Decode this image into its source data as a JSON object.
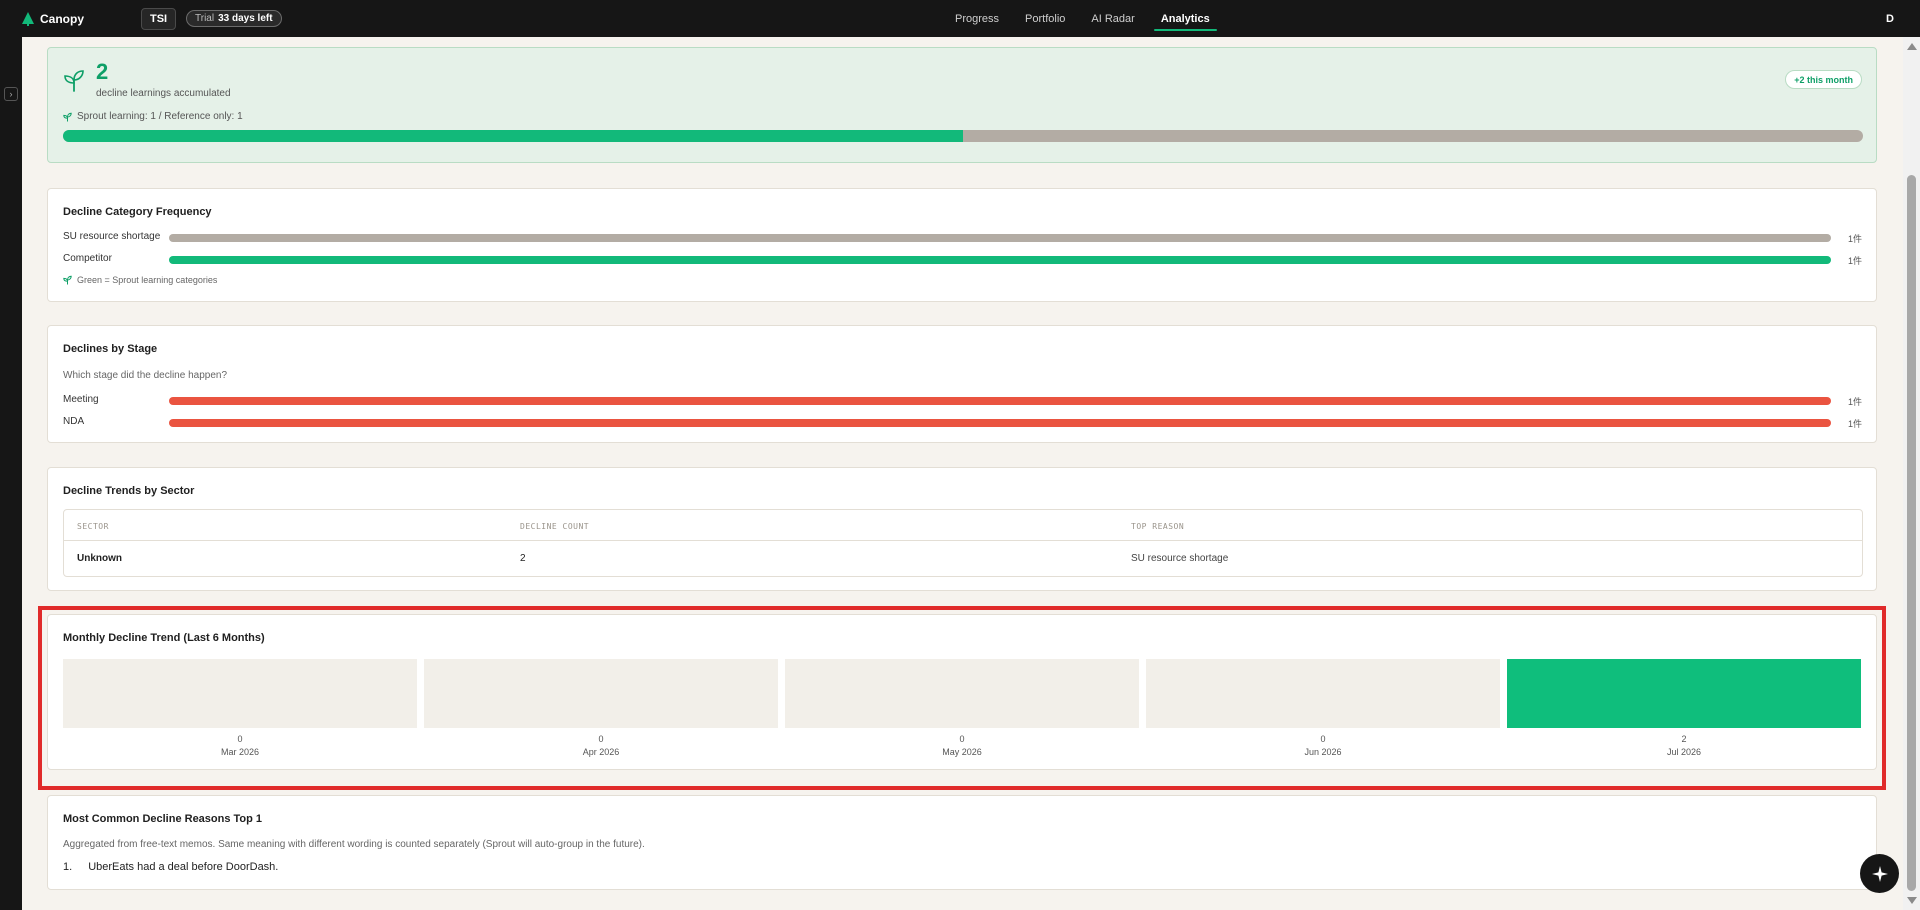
{
  "nav": {
    "brand": "Canopy",
    "org": "TSI",
    "trial_label": "Trial",
    "trial_days": "33 days left",
    "tabs": [
      {
        "label": "Progress"
      },
      {
        "label": "Portfolio"
      },
      {
        "label": "AI Radar"
      },
      {
        "label": "Analytics"
      }
    ],
    "active_tab": "Analytics",
    "user_initial": "D"
  },
  "summary": {
    "count": "2",
    "subtitle": "decline learnings accumulated",
    "month_badge": "+2 this month",
    "breakdown": "Sprout learning: 1 / Reference only: 1",
    "sprout_share": 0.5
  },
  "category_frequency": {
    "title": "Decline Category Frequency",
    "rows": [
      {
        "label": "SU resource shortage",
        "count": "1件",
        "sprout": false
      },
      {
        "label": "Competitor",
        "count": "1件",
        "sprout": true
      }
    ],
    "note": "Green = Sprout learning categories"
  },
  "by_stage": {
    "title": "Declines by Stage",
    "description": "Which stage did the decline happen?",
    "rows": [
      {
        "label": "Meeting",
        "count": "1件"
      },
      {
        "label": "NDA",
        "count": "1件"
      }
    ]
  },
  "by_sector": {
    "title": "Decline Trends by Sector",
    "columns": [
      "SECTOR",
      "DECLINE COUNT",
      "TOP REASON"
    ],
    "rows": [
      {
        "sector": "Unknown",
        "count": "2",
        "reason": "SU resource shortage"
      }
    ]
  },
  "monthly": {
    "title": "Monthly Decline Trend (Last 6 Months)",
    "months": [
      {
        "label": "Mar 2026",
        "value": "0"
      },
      {
        "label": "Apr 2026",
        "value": "0"
      },
      {
        "label": "May 2026",
        "value": "0"
      },
      {
        "label": "Jun 2026",
        "value": "0"
      },
      {
        "label": "Jul 2026",
        "value": "2"
      }
    ]
  },
  "reasons": {
    "title": "Most Common Decline Reasons Top 1",
    "description": "Aggregated from free-text memos. Same meaning with different wording is counted separately (Sprout will auto-group in the future).",
    "items": [
      {
        "rank": "1.",
        "text": "UberEats had a deal before DoorDash."
      }
    ]
  },
  "colors": {
    "accent": "#12b97a",
    "stage_bar": "#ea5440",
    "neutral_bar": "#b3aca4",
    "highlight": "#e02a2a"
  },
  "fab_icon": "sparkle-icon"
}
